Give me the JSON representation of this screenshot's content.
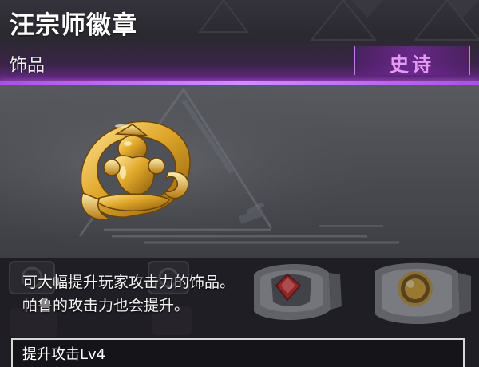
{
  "item": {
    "name": "汪宗师徽章",
    "type": "饰品",
    "rarity": "史诗",
    "rarity_color": "#e59af5"
  },
  "description": {
    "line1": "可大幅提升玩家攻击力的饰品。",
    "line2": "帕鲁的攻击力也会提升。"
  },
  "effect": {
    "label": "提升攻击Lv4"
  },
  "icons": {
    "main": "gold-emblem-icon",
    "background": [
      "ring-red-gem-icon",
      "ring-amber-gem-icon",
      "emblem-tile-icon"
    ]
  },
  "colors": {
    "accent": "#c77ae6",
    "divider": "#b04ee0"
  }
}
